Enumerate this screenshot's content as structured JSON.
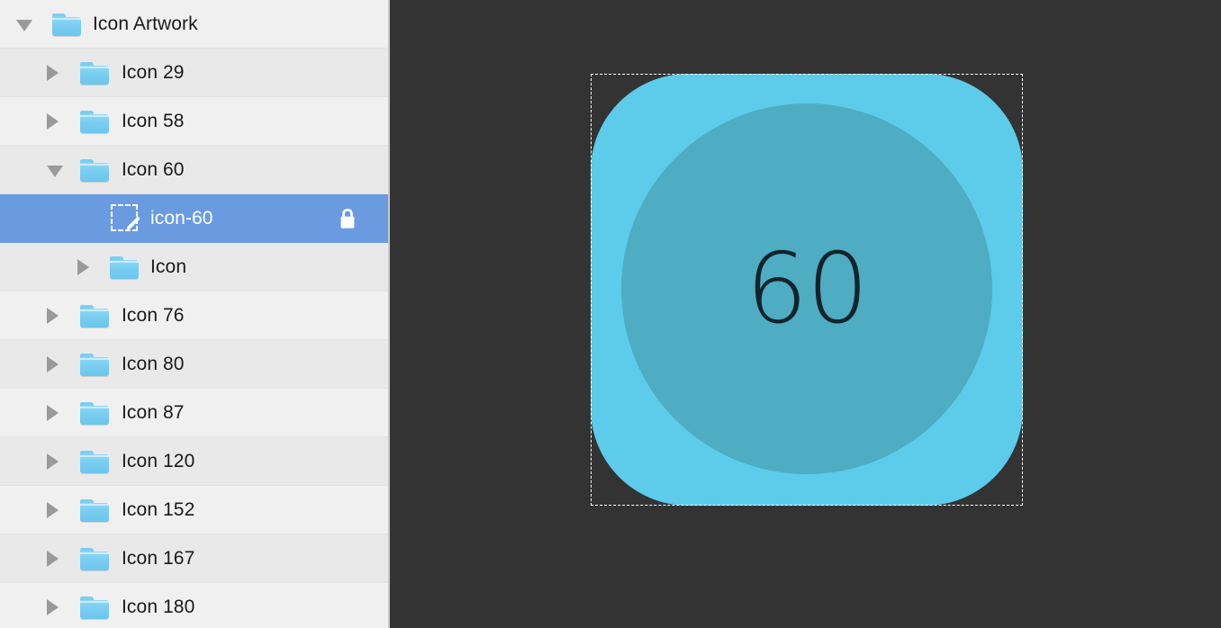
{
  "window": {
    "title": "Icon Artwork",
    "canvas_background": "#333333",
    "selection_color": "#6a9be0"
  },
  "sidebar": {
    "name": "layer-outline",
    "rows": [
      {
        "label": "Icon Artwork",
        "icon": "folder-icon",
        "disclosure": "chevron-down-icon",
        "depth": 0,
        "selected": false,
        "locked": false,
        "striped": false
      },
      {
        "label": "Icon 29",
        "icon": "folder-icon",
        "disclosure": "chevron-right-icon",
        "depth": 1,
        "selected": false,
        "locked": false,
        "striped": true
      },
      {
        "label": "Icon 58",
        "icon": "folder-icon",
        "disclosure": "chevron-right-icon",
        "depth": 1,
        "selected": false,
        "locked": false,
        "striped": false
      },
      {
        "label": "Icon 60",
        "icon": "folder-icon",
        "disclosure": "chevron-down-icon",
        "depth": 1,
        "selected": false,
        "locked": false,
        "striped": true
      },
      {
        "label": "icon-60",
        "icon": "artboard-icon",
        "disclosure": "none",
        "depth": 2,
        "selected": true,
        "locked": true,
        "striped": false
      },
      {
        "label": "Icon",
        "icon": "folder-icon",
        "disclosure": "chevron-right-icon",
        "depth": 2,
        "selected": false,
        "locked": false,
        "striped": true
      },
      {
        "label": "Icon 76",
        "icon": "folder-icon",
        "disclosure": "chevron-right-icon",
        "depth": 1,
        "selected": false,
        "locked": false,
        "striped": false
      },
      {
        "label": "Icon 80",
        "icon": "folder-icon",
        "disclosure": "chevron-right-icon",
        "depth": 1,
        "selected": false,
        "locked": false,
        "striped": true
      },
      {
        "label": "Icon 87",
        "icon": "folder-icon",
        "disclosure": "chevron-right-icon",
        "depth": 1,
        "selected": false,
        "locked": false,
        "striped": false
      },
      {
        "label": "Icon 120",
        "icon": "folder-icon",
        "disclosure": "chevron-right-icon",
        "depth": 1,
        "selected": false,
        "locked": false,
        "striped": true
      },
      {
        "label": "Icon 152",
        "icon": "folder-icon",
        "disclosure": "chevron-right-icon",
        "depth": 1,
        "selected": false,
        "locked": false,
        "striped": false
      },
      {
        "label": "Icon 167",
        "icon": "folder-icon",
        "disclosure": "chevron-right-icon",
        "depth": 1,
        "selected": false,
        "locked": false,
        "striped": true
      },
      {
        "label": "Icon 180",
        "icon": "folder-icon",
        "disclosure": "chevron-right-icon",
        "depth": 1,
        "selected": false,
        "locked": false,
        "striped": false
      }
    ],
    "lock_icon": "lock-closed-icon"
  },
  "canvas": {
    "artboard_name": "icon-60",
    "artwork": {
      "background_shape": "rounded-square",
      "background_color": "#5cccea",
      "circle_color": "#4eacc3",
      "number_text": "60",
      "number_color": "#12242b"
    },
    "selection_outline": "dashed-white"
  }
}
